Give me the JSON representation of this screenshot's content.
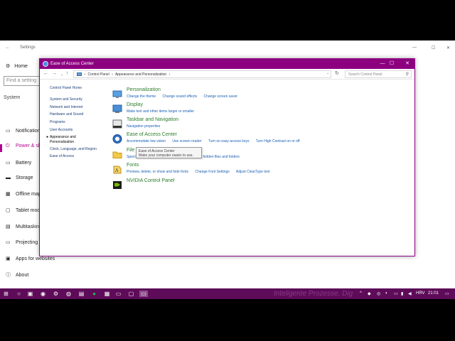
{
  "settings": {
    "title": "Settings",
    "home": "Home",
    "search_placeholder": "Find a setting",
    "section": "System",
    "items": [
      {
        "label": "Notifications & actions"
      },
      {
        "label": "Power & sleep"
      },
      {
        "label": "Battery"
      },
      {
        "label": "Storage"
      },
      {
        "label": "Offline maps"
      },
      {
        "label": "Tablet mode"
      },
      {
        "label": "Multitasking"
      },
      {
        "label": "Projecting to this PC"
      },
      {
        "label": "Apps for websites"
      },
      {
        "label": "About"
      }
    ]
  },
  "cp": {
    "title": "Ease of Access Center",
    "breadcrumb": [
      "Control Panel",
      "›",
      "Appearance and Personalization",
      "›"
    ],
    "search_placeholder": "Search Control Panel",
    "left_nav": [
      "Control Panel Home",
      "System and Security",
      "Network and Internet",
      "Hardware and Sound",
      "Programs",
      "User Accounts",
      "Appearance and",
      "Personalization",
      "Clock, Language, and Region",
      "Ease of Access"
    ],
    "categories": [
      {
        "title": "Personalization",
        "links": [
          "Change the theme",
          "Change sound effects",
          "Change screen saver"
        ]
      },
      {
        "title": "Display",
        "links": [
          "Make text and other items larger or smaller"
        ]
      },
      {
        "title": "Taskbar and Navigation",
        "links": [
          "Navigation properties"
        ]
      },
      {
        "title": "Ease of Access Center",
        "links": [
          "Accommodate low vision",
          "Use screen reader",
          "Turn on easy access keys",
          "Turn High Contrast on or off"
        ]
      },
      {
        "title": "File",
        "links": [
          "Specify single- or double-click to open",
          "Show hidden files and folders"
        ]
      },
      {
        "title": "Fonts",
        "links": [
          "Preview, delete, or show and hide fonts",
          "Change Font Settings",
          "Adjust ClearType text"
        ]
      },
      {
        "title": "NVIDIA Control Panel",
        "links": []
      }
    ],
    "tooltip_line1": "Ease of Access Center",
    "tooltip_line2": "Make your computer easier to use."
  },
  "taskbar": {
    "watermark": "Inteligente Prozesse, Dig",
    "language": "HRV",
    "time": "21:01"
  },
  "colors": {
    "accent": "#8c0080",
    "link": "#1a5fb4",
    "category": "#2a7d2a"
  }
}
